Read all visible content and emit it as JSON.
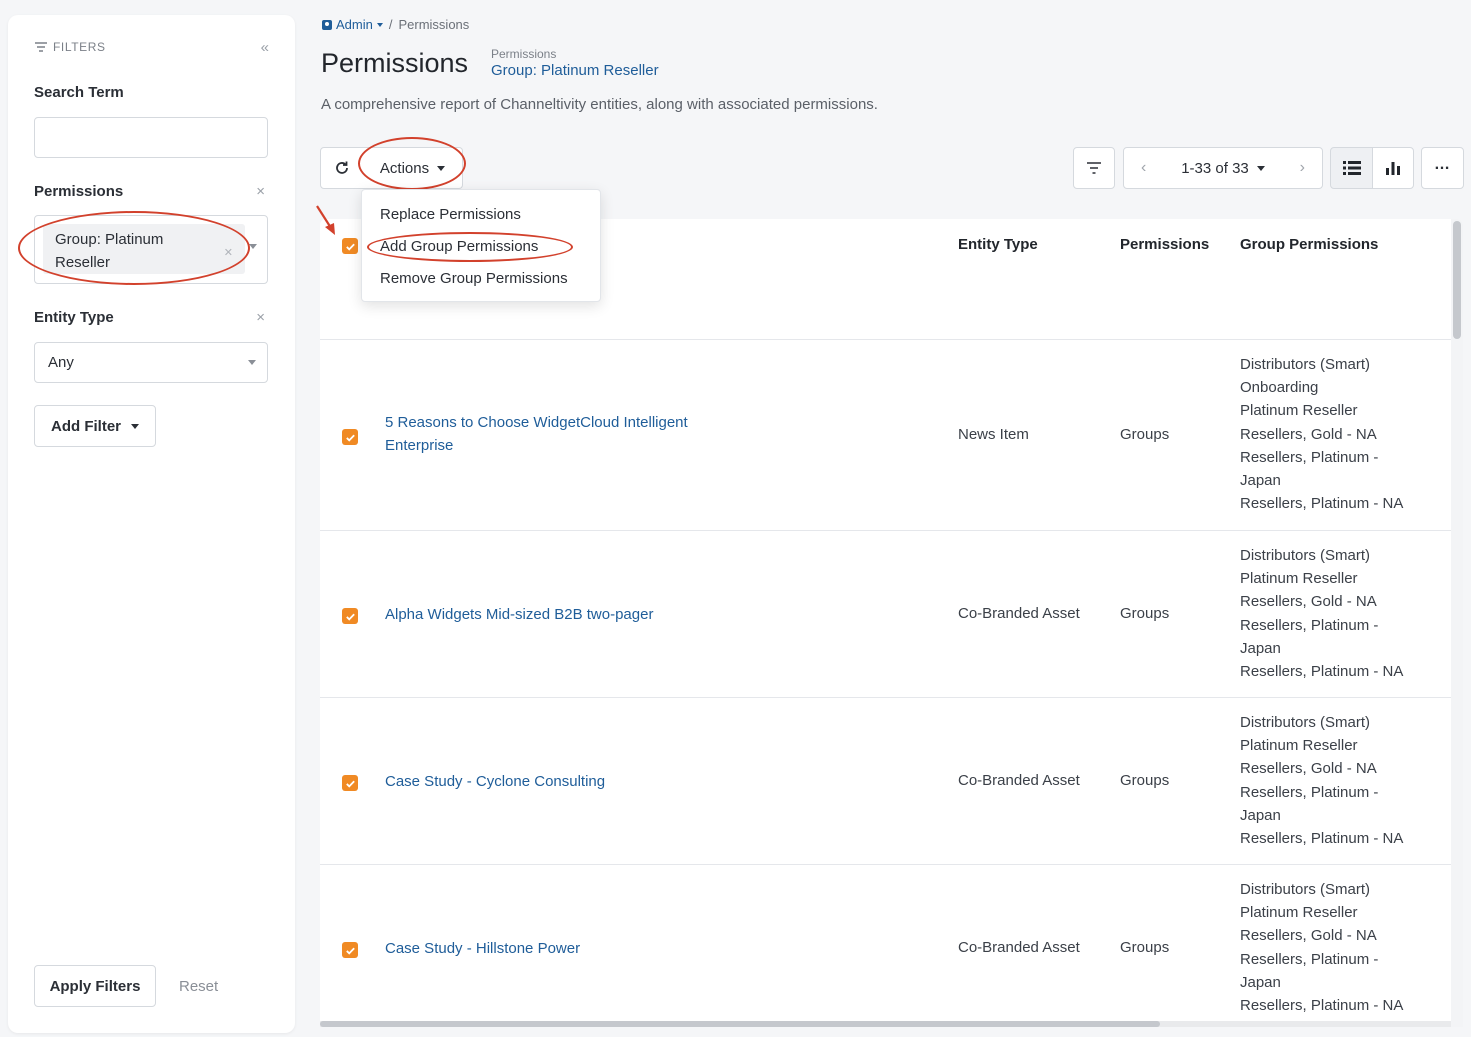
{
  "sidebar": {
    "filters_label": "FILTERS",
    "search_term_label": "Search Term",
    "search_term_value": "",
    "permissions_label": "Permissions",
    "permissions_chip": "Group: Platinum Reseller",
    "permissions_chip_line1": "Group: Platinum",
    "permissions_chip_line2": "Reseller",
    "entity_type_label": "Entity Type",
    "entity_type_value": "Any",
    "add_filter_label": "Add Filter",
    "apply_label": "Apply Filters",
    "reset_label": "Reset"
  },
  "breadcrumb": {
    "admin": "Admin",
    "separator": "/",
    "current": "Permissions"
  },
  "header": {
    "title": "Permissions",
    "context_label": "Permissions",
    "context_value": "Group: Platinum Reseller",
    "description": "A comprehensive report of Channeltivity entities, along with associated permissions."
  },
  "toolbar": {
    "actions_label": "Actions",
    "pagination": "1-33 of 33"
  },
  "actions_menu": {
    "items": [
      "Replace Permissions",
      "Add Group Permissions",
      "Remove Group Permissions"
    ]
  },
  "table": {
    "columns": {
      "entity_type": "Entity Type",
      "permissions": "Permissions",
      "group_permissions": "Group Permissions"
    },
    "rows": [
      {
        "name_line1": "5 Reasons to Choose WidgetCloud Intelligent",
        "name_line2": "Enterprise",
        "entity_type": "News Item",
        "permissions": "Groups",
        "groups": [
          "Distributors (Smart)",
          "Onboarding",
          "Platinum Reseller",
          "Resellers, Gold - NA",
          "Resellers, Platinum -",
          "Japan",
          "Resellers, Platinum - NA"
        ]
      },
      {
        "name_line1": "Alpha Widgets Mid-sized B2B two-pager",
        "name_line2": "",
        "entity_type": "Co-Branded Asset",
        "permissions": "Groups",
        "groups": [
          "Distributors (Smart)",
          "Platinum Reseller",
          "Resellers, Gold - NA",
          "Resellers, Platinum -",
          "Japan",
          "Resellers, Platinum - NA"
        ]
      },
      {
        "name_line1": "Case Study - Cyclone Consulting",
        "name_line2": "",
        "entity_type": "Co-Branded Asset",
        "permissions": "Groups",
        "groups": [
          "Distributors (Smart)",
          "Platinum Reseller",
          "Resellers, Gold - NA",
          "Resellers, Platinum -",
          "Japan",
          "Resellers, Platinum - NA"
        ]
      },
      {
        "name_line1": "Case Study - Hillstone Power",
        "name_line2": "",
        "entity_type": "Co-Branded Asset",
        "permissions": "Groups",
        "groups": [
          "Distributors (Smart)",
          "Platinum Reseller",
          "Resellers, Gold - NA",
          "Resellers, Platinum -",
          "Japan",
          "Resellers, Platinum - NA"
        ]
      }
    ]
  },
  "colors": {
    "accent_orange": "#f08a24",
    "link_blue": "#1f5d99",
    "annotation_red": "#d2412c"
  }
}
